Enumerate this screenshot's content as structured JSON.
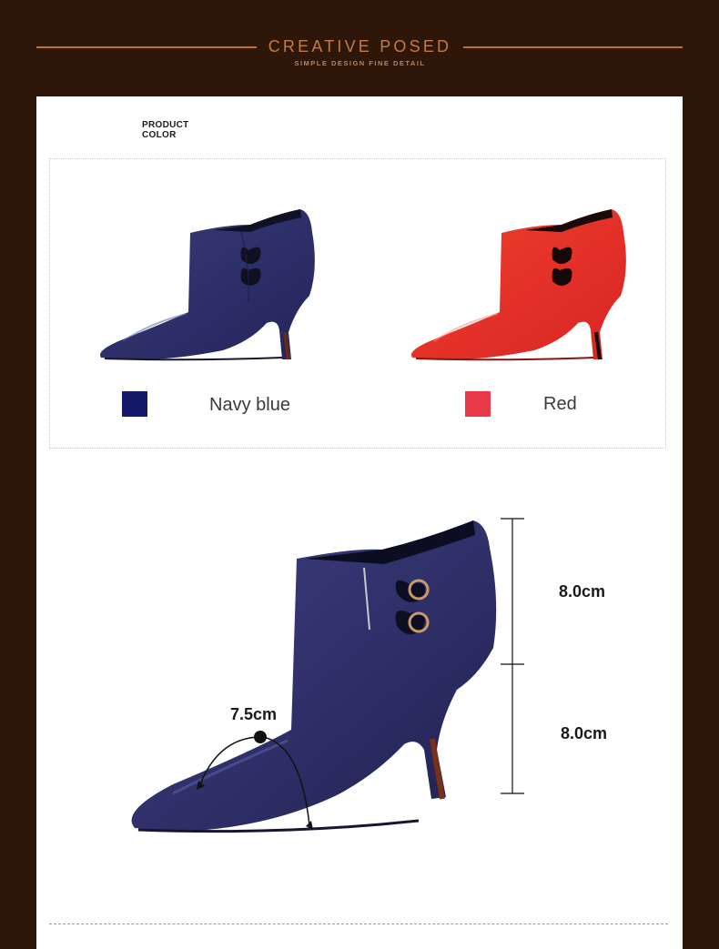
{
  "header": {
    "title": "CREATIVE POSED",
    "subtitle": "SIMPLE DESIGN FINE DETAIL"
  },
  "product_color": {
    "label_line1": "PRODUCT",
    "label_line2": "COLOR",
    "options": [
      {
        "name": "Navy blue",
        "swatch": "#131868"
      },
      {
        "name": "Red",
        "swatch": "#e8394a"
      }
    ]
  },
  "measurements": {
    "shaft_height": "8.0cm",
    "heel_height": "8.0cm",
    "toe_width": "7.5cm"
  },
  "colors": {
    "background": "#2e1708",
    "accent": "#c27b45",
    "navy_leather": "#2f2f6b",
    "red_leather": "#e8322c"
  }
}
